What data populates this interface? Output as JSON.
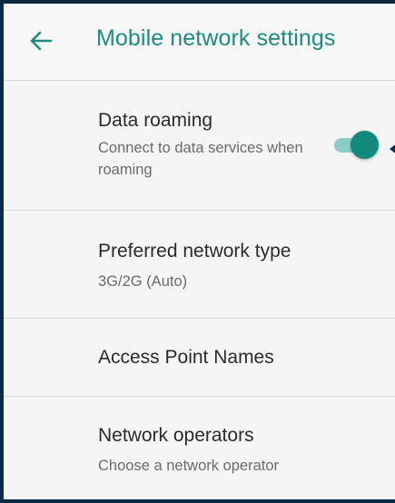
{
  "header": {
    "title": "Mobile network settings",
    "back_icon": "arrow-left-icon"
  },
  "settings": [
    {
      "title": "Data roaming",
      "subtitle": "Connect to data services when roaming",
      "control": "toggle",
      "toggle_on": true
    },
    {
      "title": "Preferred network type",
      "subtitle": "3G/2G (Auto)"
    },
    {
      "title": "Access Point Names"
    },
    {
      "title": "Network operators",
      "subtitle": "Choose a network operator"
    }
  ],
  "colors": {
    "accent": "#1f8b80",
    "toggle_thumb": "#11897d",
    "toggle_track": "#8ecdc6",
    "frame_border": "#0b2a44",
    "annotation_red": "#cc1f1f",
    "annotation_dark": "#0d2c4a"
  }
}
